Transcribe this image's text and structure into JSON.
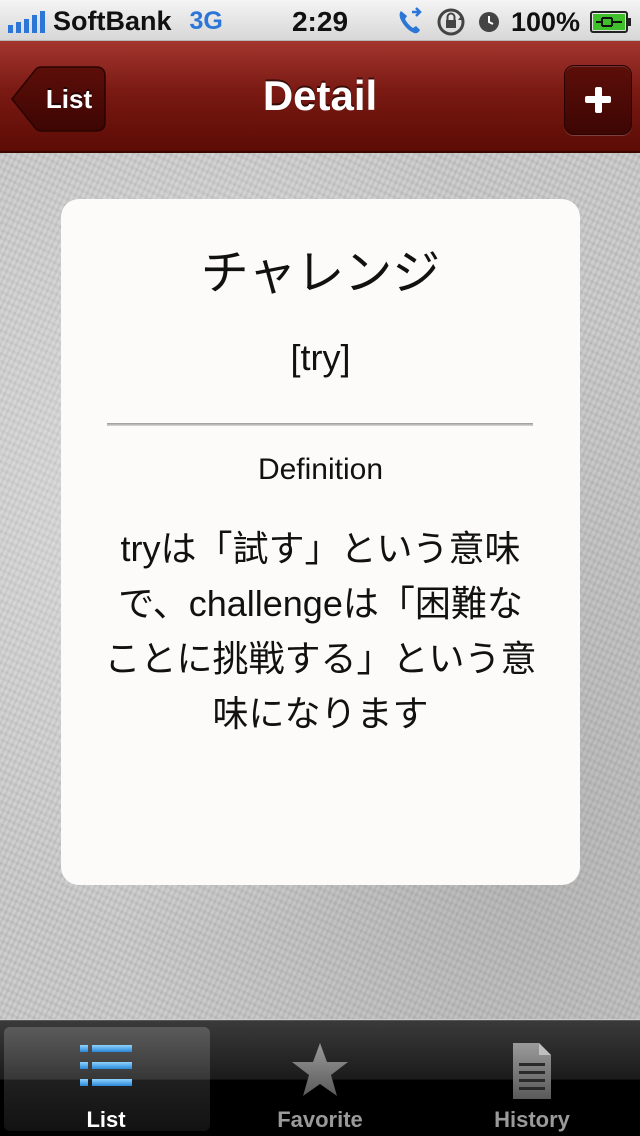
{
  "status_bar": {
    "carrier": "SoftBank",
    "network": "3G",
    "time": "2:29",
    "battery": "100%"
  },
  "nav": {
    "title": "Detail",
    "back_label": "List",
    "add_icon": "plus-icon"
  },
  "entry": {
    "word": "チャレンジ",
    "reading": "[try]",
    "definition_label": "Definition",
    "definition": "tryは「試す」という意味で、challengeは「困難なことに挑戦する」という意味になります"
  },
  "tabs": [
    {
      "label": "List",
      "icon": "list-icon",
      "selected": true
    },
    {
      "label": "Favorite",
      "icon": "star-icon",
      "selected": false
    },
    {
      "label": "History",
      "icon": "document-icon",
      "selected": false
    }
  ],
  "colors": {
    "nav_bar": "#7a1a13",
    "card": "#fcfbf9",
    "tab_selected_icon": "#4aa6e8",
    "tab_unselected": "#9a9a9a"
  }
}
